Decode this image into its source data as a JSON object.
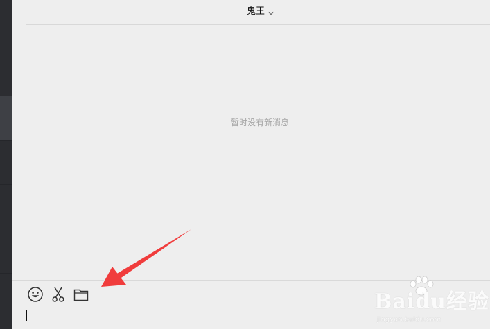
{
  "header": {
    "title": "鬼王",
    "dropdown_icon": "chevron-down-icon"
  },
  "messages": {
    "empty_text": "暂时没有新消息"
  },
  "toolbar": {
    "emoji_icon": "emoji-icon",
    "screenshot_icon": "scissors-icon",
    "file_icon": "folder-icon"
  },
  "annotation": {
    "color": "#f03c3c"
  },
  "watermark": {
    "brand": "Baidu经验",
    "url": "jingyan.baidu.com"
  }
}
